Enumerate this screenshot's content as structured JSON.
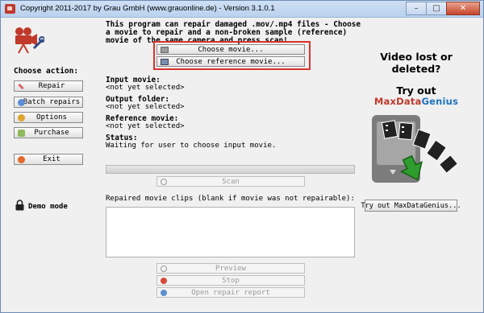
{
  "window": {
    "title": "Copyright 2011-2017 by Grau GmbH (www.grauonline.de) - Version 3.1.0.1",
    "buttons": [
      "–",
      "□",
      "✕"
    ]
  },
  "sidebar": {
    "heading": "Choose action:",
    "items": [
      {
        "label": "Repair",
        "icon": "wrench-icon"
      },
      {
        "label": "Batch repairs",
        "icon": "batch-icon"
      },
      {
        "label": "Options",
        "icon": "options-icon"
      },
      {
        "label": "Purchase",
        "icon": "cart-icon"
      },
      {
        "label": "Exit",
        "icon": "exit-icon"
      }
    ],
    "demo_mode": "Demo mode"
  },
  "main": {
    "description": "This program can repair damaged .mov/.mp4 files - Choose a movie to repair and a non-broken sample (reference) movie of the same camera and press scan!",
    "choose_movie": "Choose movie...",
    "choose_reference": "Choose reference movie...",
    "input_label": "Input movie:",
    "input_value": "<not yet selected>",
    "output_label": "Output folder:",
    "output_value": "<not yet selected>",
    "reference_label": "Reference movie:",
    "reference_value": "<not yet selected>",
    "status_label": "Status:",
    "status_value": "Waiting for user to choose input movie.",
    "progress": 0,
    "scan": "Scan",
    "clips_label": "Repaired movie clips (blank if movie was not repairable):",
    "preview": "Preview",
    "stop": "Stop",
    "open_report": "Open repair report"
  },
  "promo": {
    "line1": "Video lost or deleted?",
    "line2": "Try out",
    "brand_a": "MaxData",
    "brand_b": "Genius",
    "button": "Try out MaxDataGenius..."
  },
  "colors": {
    "highlight": "#d9322b",
    "brand_red": "#c0392b",
    "brand_blue": "#1e73be"
  }
}
